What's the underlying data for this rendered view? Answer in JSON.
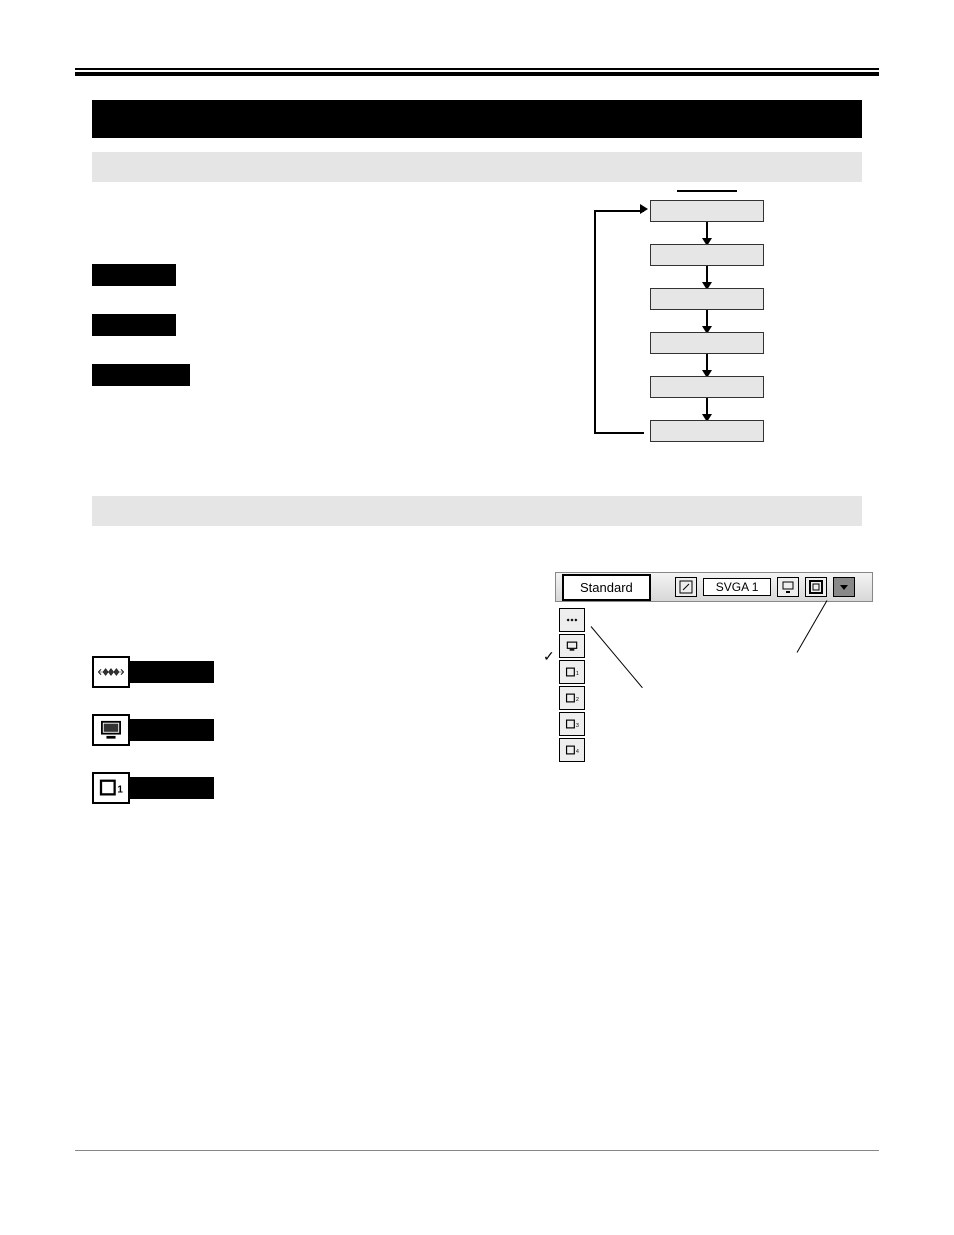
{
  "toolbar": {
    "standard_label": "Standard",
    "svga_label": "SVGA 1",
    "vertical_items": [
      "◇",
      "▣",
      "1",
      "2",
      "3",
      "4"
    ]
  },
  "icons": {
    "diamond_chain": "diamond-chain-icon",
    "monitor": "monitor-icon",
    "square_1": "square-1-icon"
  },
  "flowchart": {
    "box_count": 6
  }
}
